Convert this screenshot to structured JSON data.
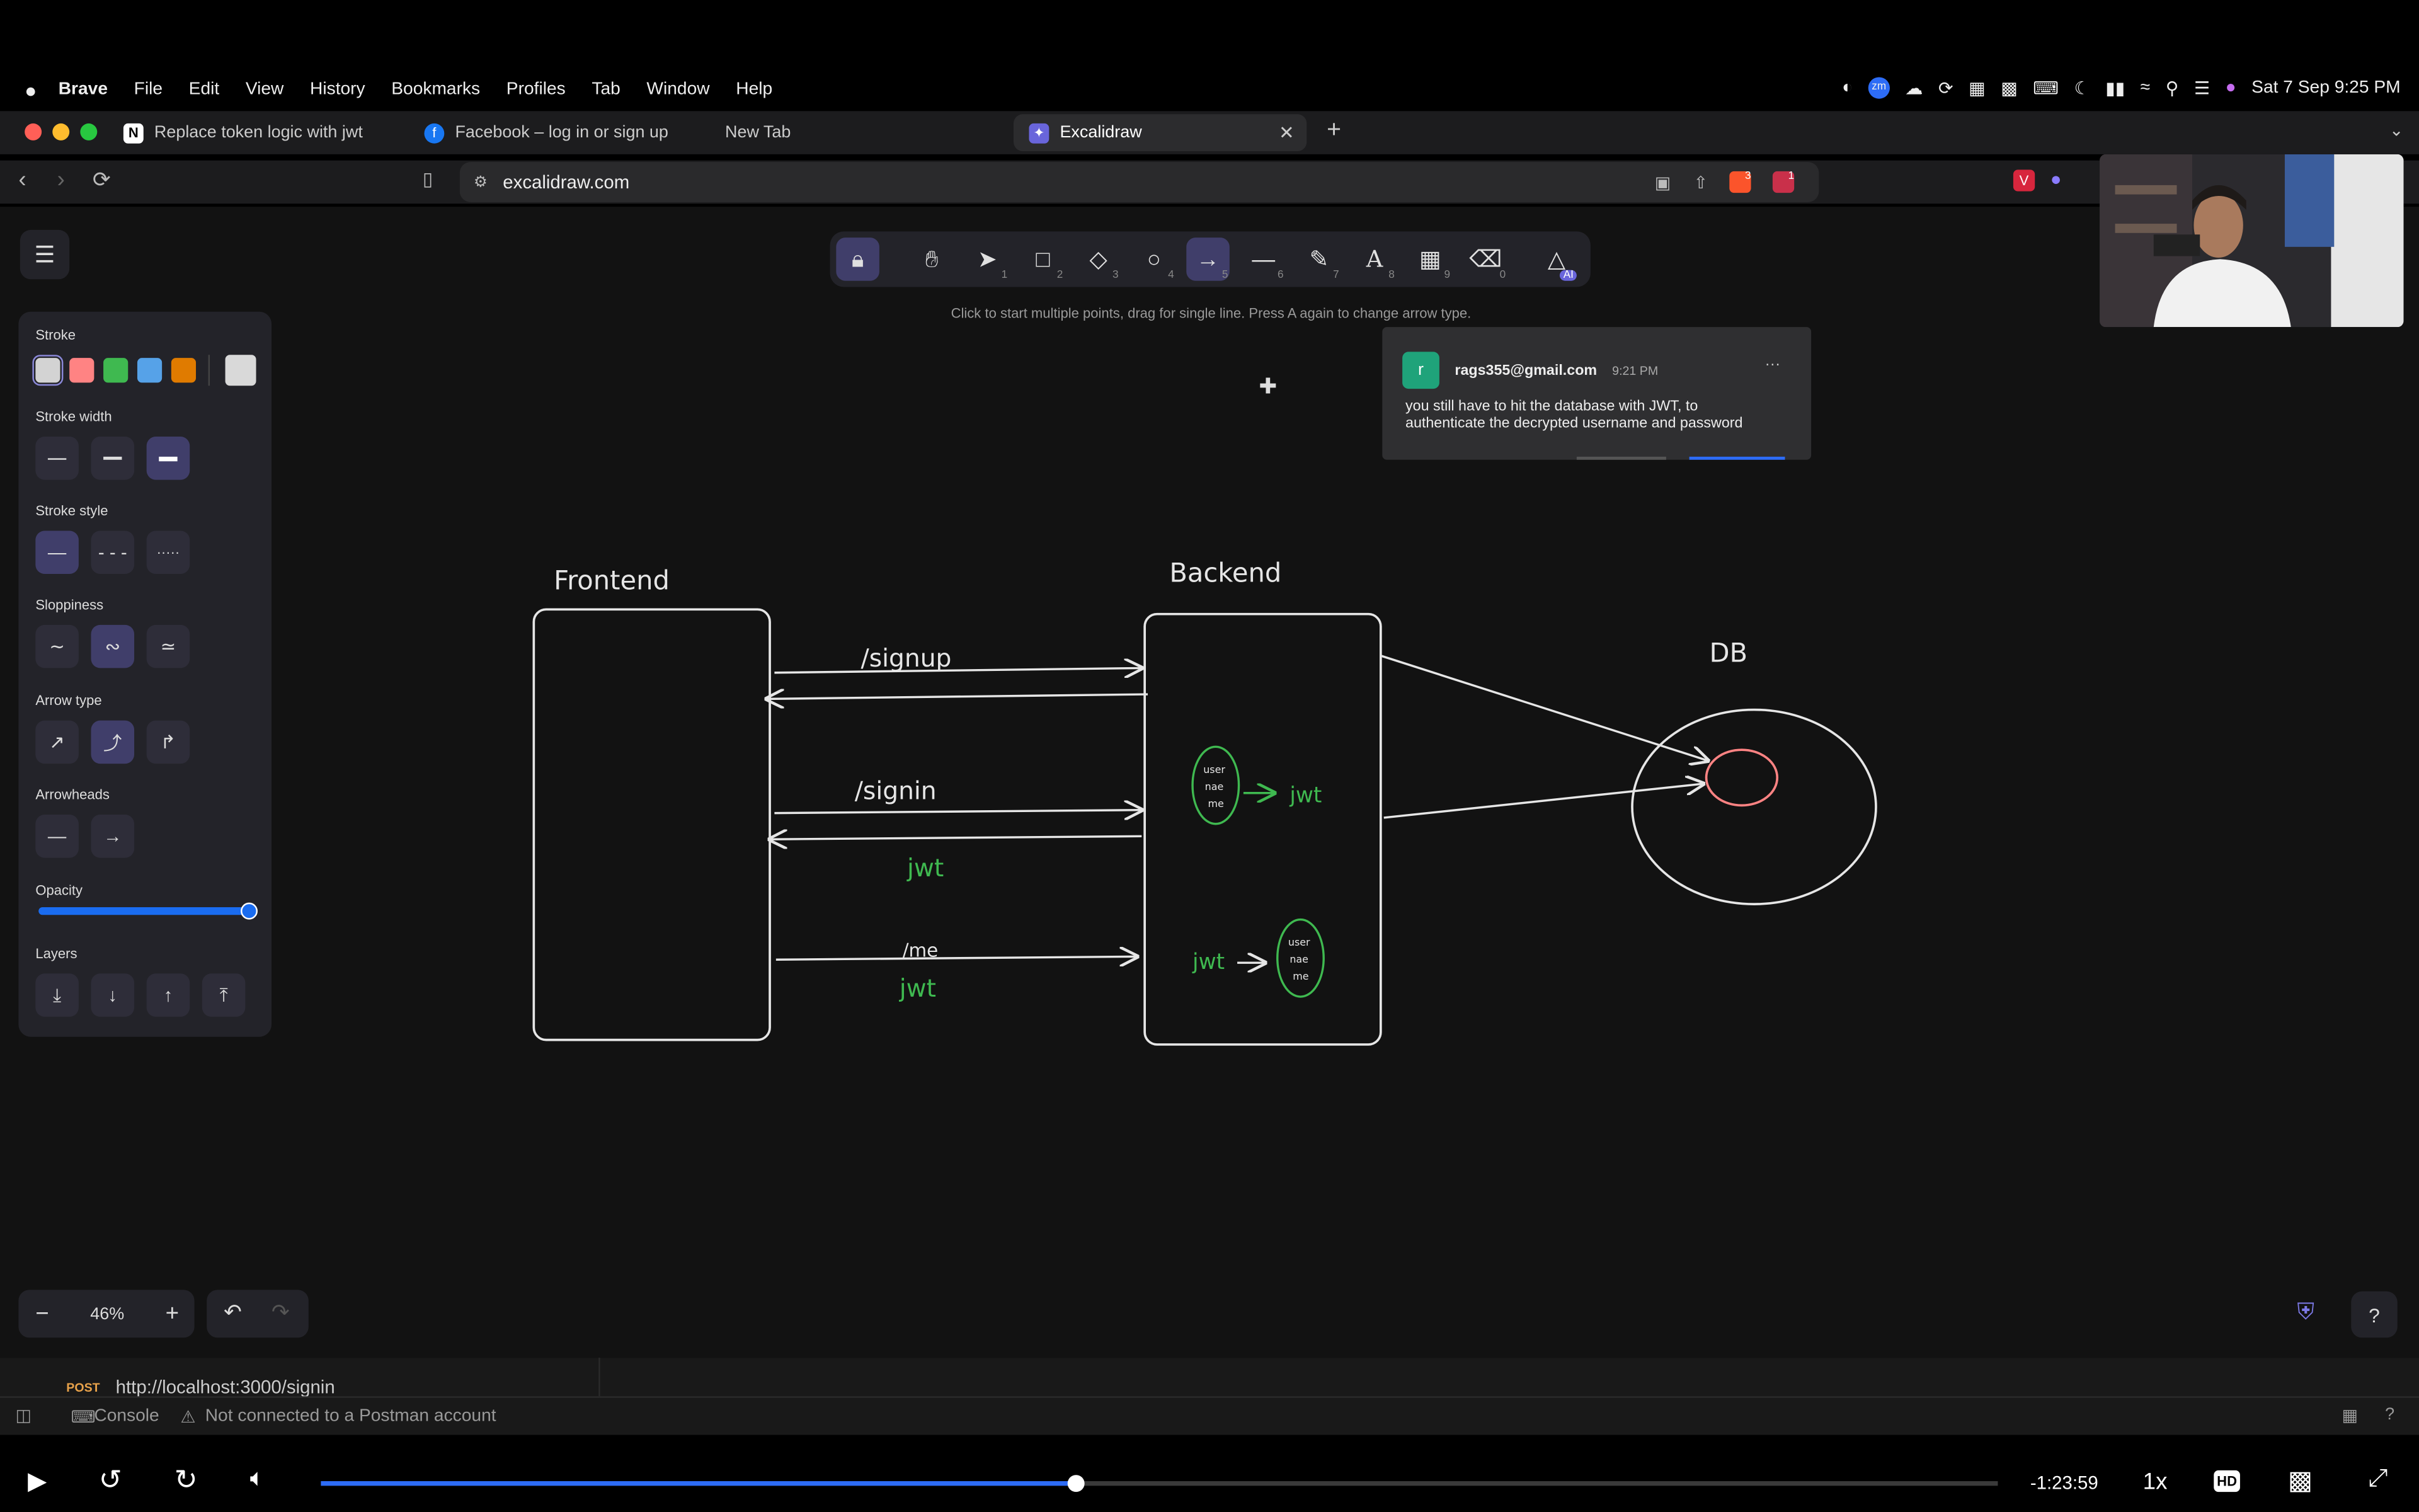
{
  "menubar": {
    "apple": "",
    "items": [
      "Brave",
      "File",
      "Edit",
      "View",
      "History",
      "Bookmarks",
      "Profiles",
      "Tab",
      "Window",
      "Help"
    ],
    "datetime": "Sat 7 Sep  9:25 PM",
    "zoom_badge": "zm"
  },
  "tabs": [
    {
      "title": "Replace token logic with jwt",
      "icon": "notion-icon"
    },
    {
      "title": "Facebook – log in or sign up",
      "icon": "facebook-icon"
    },
    {
      "title": "New Tab",
      "icon": ""
    },
    {
      "title": "Excalidraw",
      "icon": "excalidraw-icon",
      "active": true
    }
  ],
  "address": {
    "url": "excalidraw.com",
    "brave_count": "3",
    "alert_count": "1"
  },
  "toolbar": {
    "keys": [
      "1",
      "2",
      "3",
      "4",
      "5",
      "6",
      "7",
      "8",
      "9",
      "0"
    ],
    "ai_badge": "AI",
    "hint": "Click to start multiple points, drag for single line. Press A again to change arrow type."
  },
  "props": {
    "stroke": "Stroke",
    "stroke_width": "Stroke width",
    "stroke_style": "Stroke style",
    "sloppiness": "Sloppiness",
    "arrow_type": "Arrow type",
    "arrowheads": "Arrowheads",
    "opacity": "Opacity",
    "layers": "Layers",
    "opacity_value": 1.0,
    "colors": [
      "#d3d3d3",
      "#ff8383",
      "#3fb950",
      "#56a2e8",
      "#e07b00"
    ],
    "current_color": "#d9d9d9"
  },
  "zoom": {
    "value": "46%"
  },
  "notification": {
    "avatar": "r",
    "sender": "rags355@gmail.com",
    "time": "9:21 PM",
    "more": "···",
    "line1": "you still have to hit the database with JWT, to",
    "line2": "authenticate the decrypted username and password"
  },
  "drawing": {
    "frontend": "Frontend",
    "backend": "Backend",
    "db": "DB",
    "signup": "/signup",
    "signin": "/signin",
    "me": "/me",
    "jwt": "jwt",
    "user1": "user",
    "user2": "nae",
    "user3": "me"
  },
  "postman": {
    "method": "POST",
    "url": "http://localhost:3000/signin",
    "console": "Console",
    "status": "Not connected to a Postman account"
  },
  "video": {
    "time_remaining": "-1:23:59",
    "speed": "1x",
    "hd": "HD",
    "progress": 0.45
  }
}
